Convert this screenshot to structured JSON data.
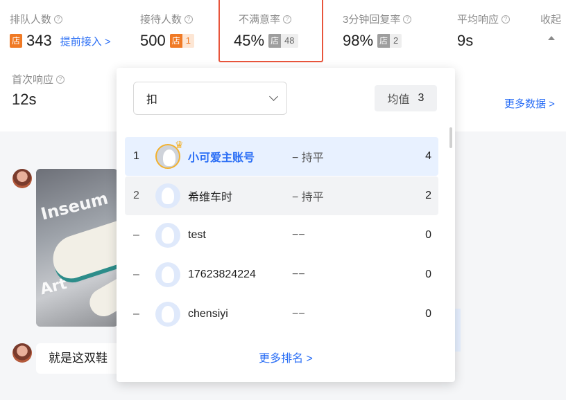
{
  "stats": {
    "queue": {
      "label": "排队人数",
      "value": "343",
      "link": "提前接入 >"
    },
    "served": {
      "label": "接待人数",
      "value": "500",
      "shop_count": "1"
    },
    "dissatisfaction": {
      "label": "不满意率",
      "value": "45%",
      "shop_count": "48"
    },
    "reply3min": {
      "label": "3分钟回复率",
      "value": "98%",
      "shop_count": "2"
    },
    "avg_response": {
      "label": "平均响应",
      "value": "9s"
    },
    "collapse": {
      "label": "收起",
      "icon": "caret-up-icon"
    },
    "first_response": {
      "label": "首次响应",
      "value": "12s"
    },
    "more_data": "更多数据 >",
    "shop_tag": "店",
    "help_icon": "question-circle-icon"
  },
  "ranking_popup": {
    "selected_metric": "扣",
    "avg_label": "均值",
    "avg_value": "3",
    "rows": [
      {
        "rank": "1",
        "name": "小可爱主账号",
        "trend": "− 持平",
        "score": "4"
      },
      {
        "rank": "2",
        "name": "希维车时",
        "trend": "− 持平",
        "score": "2"
      },
      {
        "rank": "–",
        "name": "test",
        "trend": "−−",
        "score": "0"
      },
      {
        "rank": "–",
        "name": "17623824224",
        "trend": "−−",
        "score": "0"
      },
      {
        "rank": "–",
        "name": "chensiyi",
        "trend": "−−",
        "score": "0"
      }
    ],
    "more_rank": "更多排名 >"
  },
  "chat": {
    "product_image_text": [
      "Inseum",
      "Art"
    ],
    "message_text": "就是这双鞋"
  },
  "colors": {
    "accent_blue": "#2a6ef5",
    "highlight_red": "#e8553c",
    "shop_orange": "#f07a25"
  }
}
